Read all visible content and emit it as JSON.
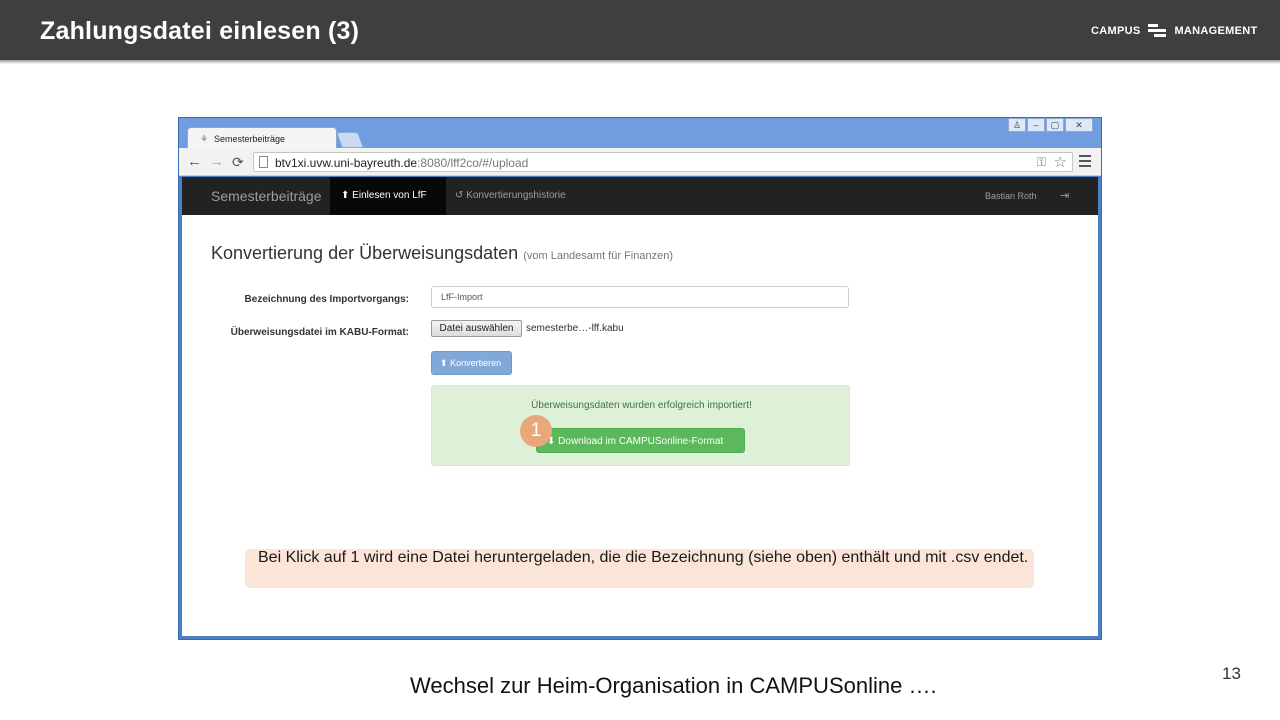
{
  "slide": {
    "title": "Zahlungsdatei einlesen (3)",
    "logo": {
      "left": "CAMPUS",
      "right": "MANAGEMENT",
      "icon": "campus-management-logo"
    },
    "footer": "Wechsel zur Heim-Organisation  in CAMPUSonline ….",
    "page_number": "13",
    "note": "Bei Klick auf 1 wird eine Datei heruntergeladen, die die Bezeichnung (siehe oben) enthält und mit .csv endet.",
    "step_badge": "1"
  },
  "browser": {
    "tab_title": "Semesterbeiträge",
    "url_host": "btv1xi.uvw.uni-bayreuth.de",
    "url_path": ":8080/lff2co/#/upload",
    "icons": {
      "back": "←",
      "forward": "→",
      "reload": "C",
      "key": "⚲",
      "star": "☆"
    },
    "window_controls": [
      "user-icon",
      "minimize-icon",
      "maximize-icon",
      "close-icon"
    ]
  },
  "app": {
    "brand": "Semesterbeiträge",
    "nav": {
      "import_label": "Einlesen von LfF",
      "history_label": "Konvertierungshistorie",
      "user": "Bastian Roth",
      "import_icon": "upload-icon",
      "history_icon": "history-icon",
      "logout_icon": "logout-icon"
    },
    "heading": "Konvertierung der Überweisungsdaten",
    "heading_sub": "(vom Landesamt für Finanzen)",
    "form": {
      "name_label": "Bezeichnung des Importvorgangs:",
      "name_value": "LfF-Import",
      "file_label": "Überweisungsdatei im KABU-Format:",
      "file_button": "Datei auswählen",
      "file_name": "semesterbe…-lff.kabu",
      "convert_button": "Konvertieren"
    },
    "alert": {
      "message": "Überweisungsdaten wurden erfolgreich importiert!",
      "download_button": "Download im CAMPUSonline-Format"
    }
  },
  "colors": {
    "header_bg": "#3f3f3f",
    "browser_frame": "#4d7fc7",
    "navbar_bg": "#222222",
    "success_bg": "#dff0d8",
    "success_btn": "#5cb85c",
    "primary_btn": "#81a8d8",
    "note_bg": "#fbe5d9",
    "badge": "#e8a87a"
  }
}
